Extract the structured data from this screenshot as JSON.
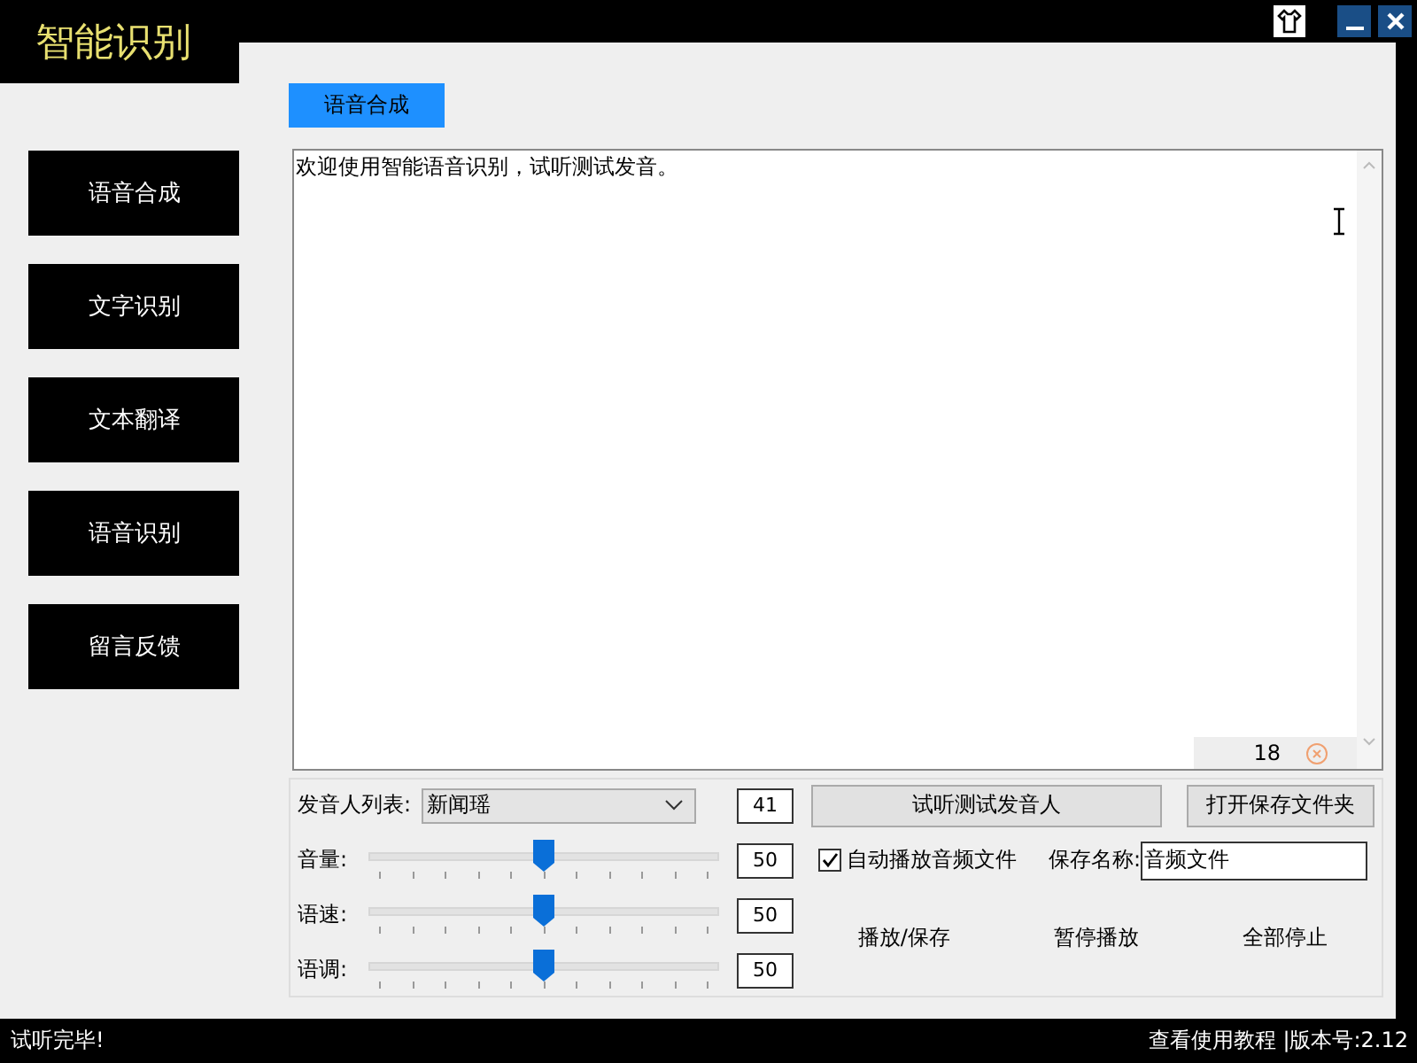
{
  "app_title": "智能识别",
  "sidebar": {
    "items": [
      {
        "label": "语音合成"
      },
      {
        "label": "文字识别"
      },
      {
        "label": "文本翻译"
      },
      {
        "label": "语音识别"
      },
      {
        "label": "留言反馈"
      }
    ]
  },
  "tabs": [
    {
      "label": "语音合成",
      "selected": true
    }
  ],
  "editor": {
    "value": "欢迎使用智能语音识别，试听测试发音。",
    "char_count": "18"
  },
  "voice": {
    "label": "发音人列表:",
    "value": "新闻瑶",
    "code": "41"
  },
  "sliders": [
    {
      "label": "音量:",
      "level": 0.5,
      "reading": "50"
    },
    {
      "label": "语速:",
      "level": 0.5,
      "reading": "50"
    },
    {
      "label": "语调:",
      "level": 0.5,
      "reading": "50"
    }
  ],
  "buttons": {
    "test": "试听测试发音人",
    "open_folder": "打开保存文件夹"
  },
  "auto_play": {
    "label": "自动播放音频文件",
    "checked": true
  },
  "save_name": {
    "label": "保存名称:",
    "value": "音频文件"
  },
  "actions": [
    "播放/保存",
    "暂停播放",
    "全部停止"
  ],
  "status_bar": {
    "message": "试听完毕!",
    "links": "查看使用教程 |版本号:2.12"
  }
}
